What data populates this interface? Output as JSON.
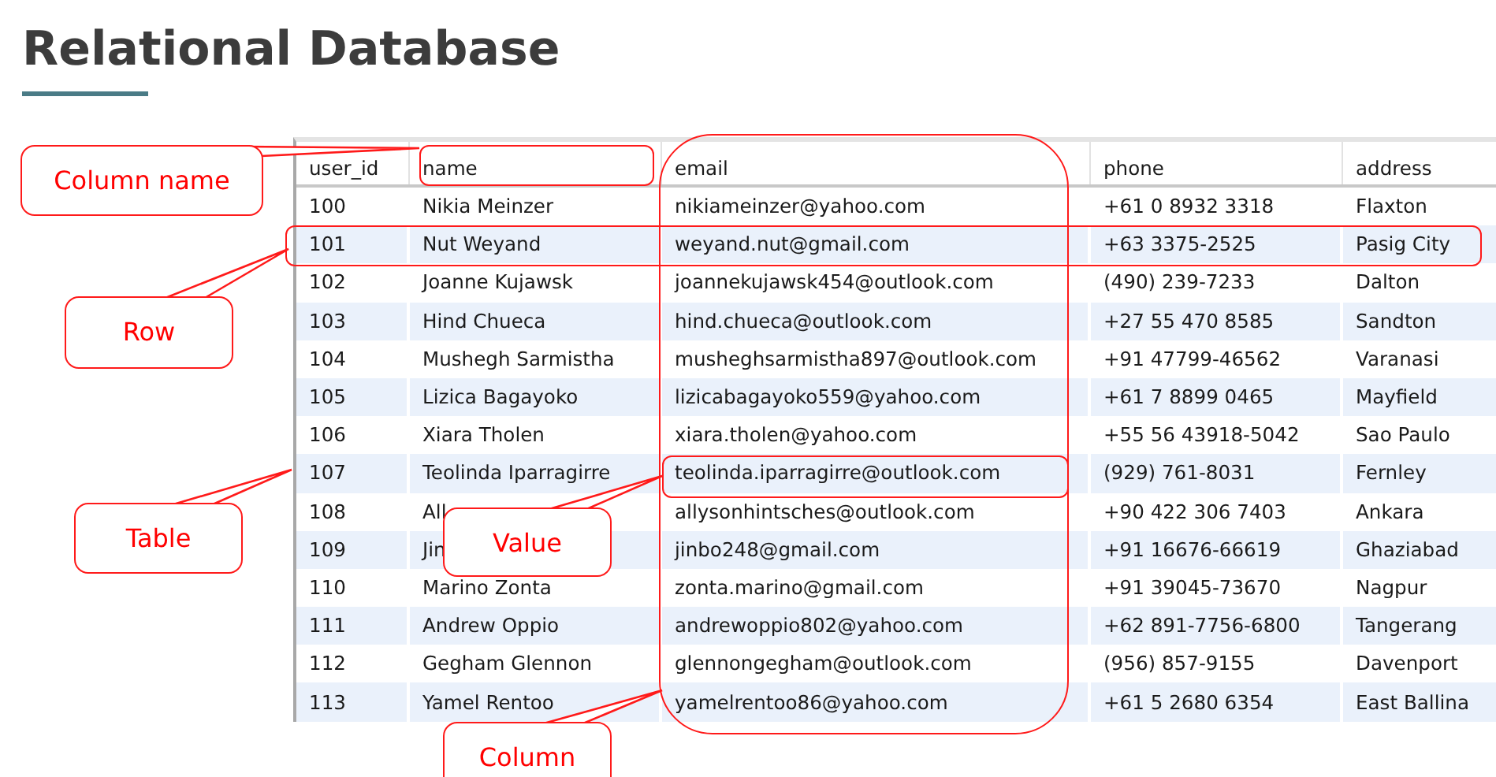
{
  "title": "Relational Database",
  "table": {
    "columns": [
      "user_id",
      "name",
      "email",
      "phone",
      "address"
    ],
    "rows": [
      [
        "100",
        "Nikia Meinzer",
        "nikiameinzer@yahoo.com",
        "+61 0 8932 3318",
        "Flaxton"
      ],
      [
        "101",
        "Nut Weyand",
        "weyand.nut@gmail.com",
        "+63 3375-2525",
        "Pasig City"
      ],
      [
        "102",
        "Joanne Kujawsk",
        "joannekujawsk454@outlook.com",
        "(490) 239-7233",
        "Dalton"
      ],
      [
        "103",
        "Hind Chueca",
        "hind.chueca@outlook.com",
        "+27 55 470 8585",
        "Sandton"
      ],
      [
        "104",
        "Mushegh Sarmistha",
        "musheghsarmistha897@outlook.com",
        "+91 47799-46562",
        "Varanasi"
      ],
      [
        "105",
        "Lizica Bagayoko",
        "lizicabagayoko559@yahoo.com",
        "+61 7 8899 0465",
        "Mayfield"
      ],
      [
        "106",
        "Xiara Tholen",
        "xiara.tholen@yahoo.com",
        "+55 56 43918-5042",
        "Sao Paulo"
      ],
      [
        "107",
        "Teolinda Iparragirre",
        "teolinda.iparragirre@outlook.com",
        "(929) 761-8031",
        "Fernley"
      ],
      [
        "108",
        "All",
        "allysonhintsches@outlook.com",
        "+90 422 306 7403",
        "Ankara"
      ],
      [
        "109",
        "Jin",
        "jinbo248@gmail.com",
        "+91 16676-66619",
        "Ghaziabad"
      ],
      [
        "110",
        "Marino Zonta",
        "zonta.marino@gmail.com",
        "+91 39045-73670",
        "Nagpur"
      ],
      [
        "111",
        "Andrew Oppio",
        "andrewoppio802@yahoo.com",
        "+62 891-7756-6800",
        "Tangerang"
      ],
      [
        "112",
        "Gegham Glennon",
        "glennongegham@outlook.com",
        "(956) 857-9155",
        "Davenport"
      ],
      [
        "113",
        "Yamel Rentoo",
        "yamelrentoo86@yahoo.com",
        "+61 5 2680 6354",
        "East Ballina"
      ]
    ]
  },
  "callouts": [
    {
      "label": "Column name"
    },
    {
      "label": "Row"
    },
    {
      "label": "Table"
    },
    {
      "label": "Value"
    },
    {
      "label": "Column"
    }
  ]
}
